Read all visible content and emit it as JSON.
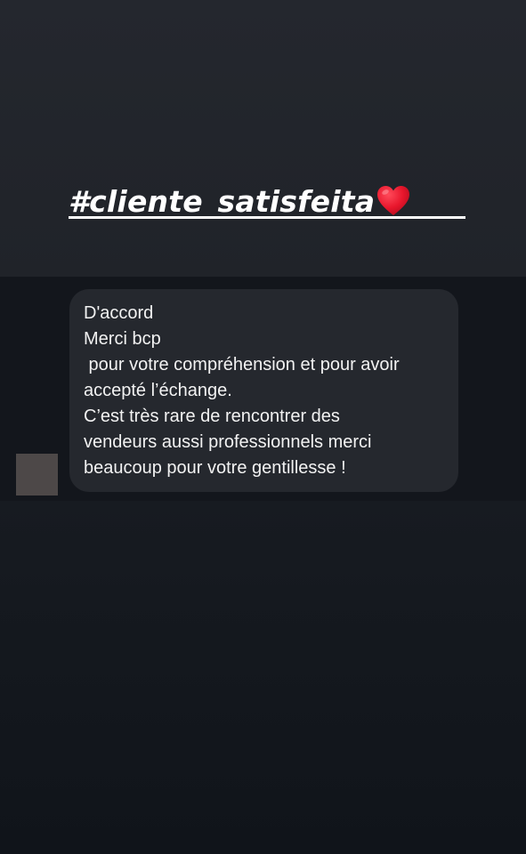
{
  "story": {
    "hashtag": "#cliente_satisfeita",
    "hashtag_icon": "red-heart-emoji"
  },
  "message": {
    "lines": [
      "D'accord",
      "Merci bcp",
      " pour votre compréhension et pour avoir",
      "accepté l’échange.",
      "C’est très rare de rencontrer des",
      "vendeurs aussi professionnels merci",
      "beaucoup pour votre gentillesse !"
    ]
  },
  "colors": {
    "background": "#1c1f26",
    "bubble": "#25282e",
    "text": "#f2f2f2",
    "heart": "#e8162c",
    "avatar": "#4d4848"
  }
}
